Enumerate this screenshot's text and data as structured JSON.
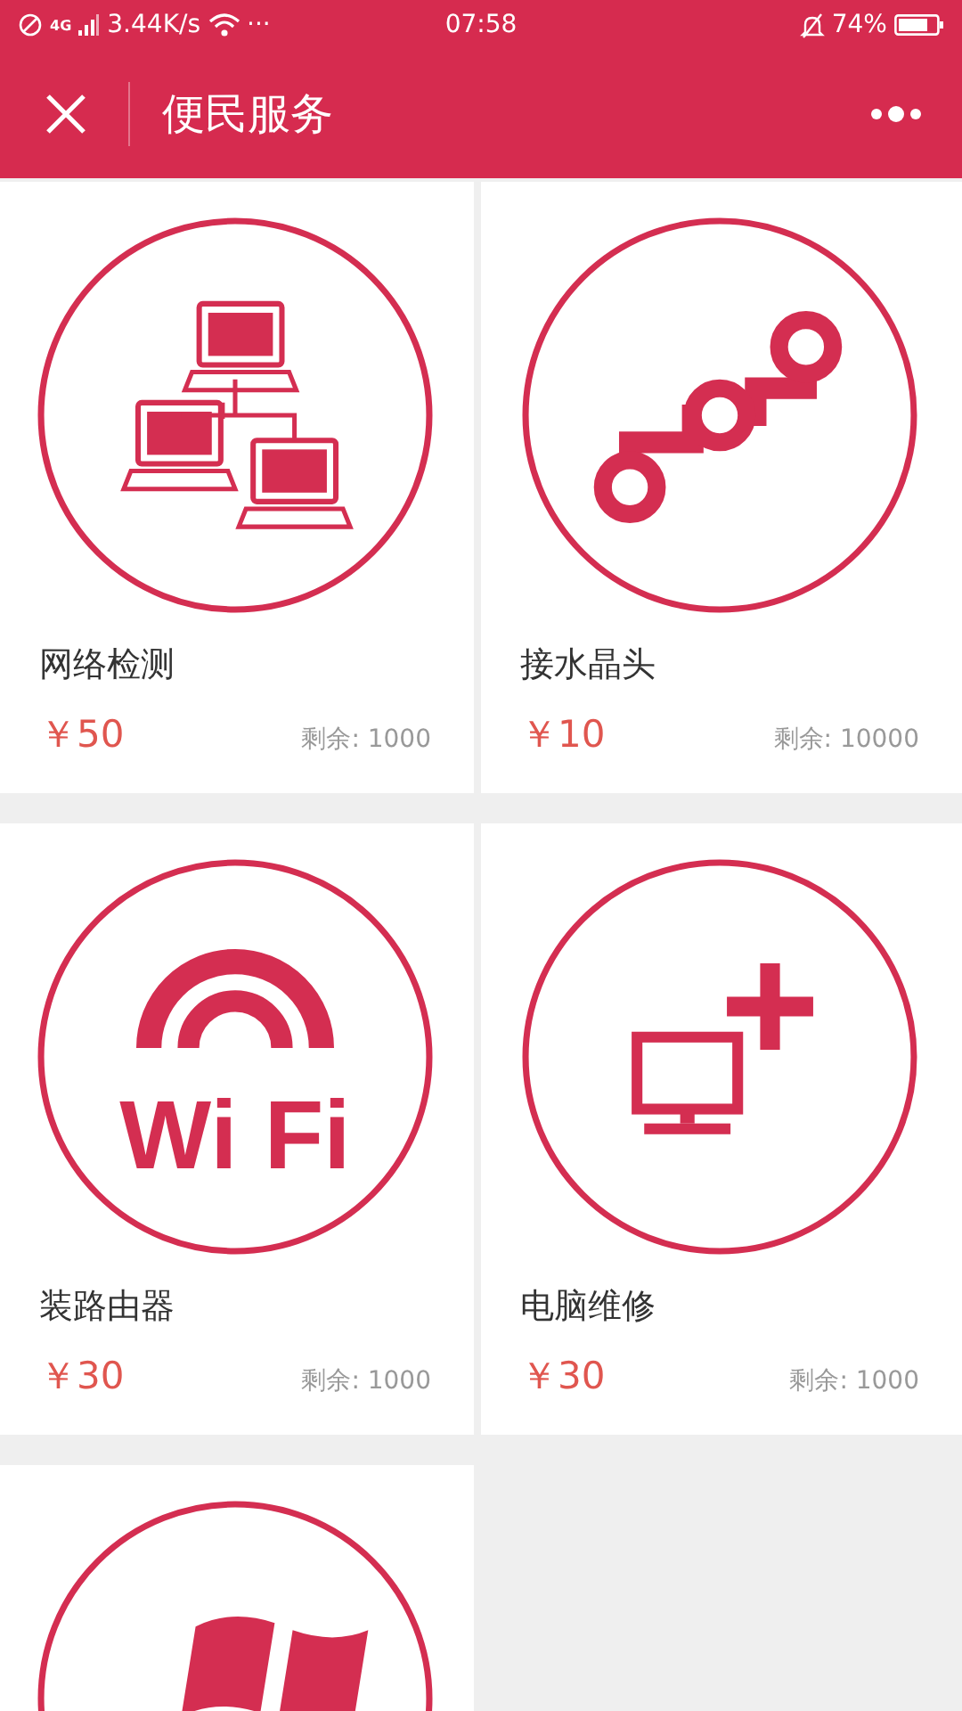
{
  "status_bar": {
    "network": "4G",
    "speed": "3.44K/s",
    "more": "···",
    "time": "07:58",
    "battery": "74%"
  },
  "header": {
    "title": "便民服务"
  },
  "services": [
    {
      "kind": "network",
      "name": "网络检测",
      "price": "￥50",
      "stock": "剩余: 1000"
    },
    {
      "kind": "pipe",
      "name": "接水晶头",
      "price": "￥10",
      "stock": "剩余: 10000"
    },
    {
      "kind": "wifi",
      "icon_text": "Wi Fi",
      "name": "装路由器",
      "price": "￥30",
      "stock": "剩余: 1000"
    },
    {
      "kind": "computer",
      "name": "电脑维修",
      "price": "￥30",
      "stock": "剩余: 1000"
    },
    {
      "kind": "windows"
    }
  ]
}
